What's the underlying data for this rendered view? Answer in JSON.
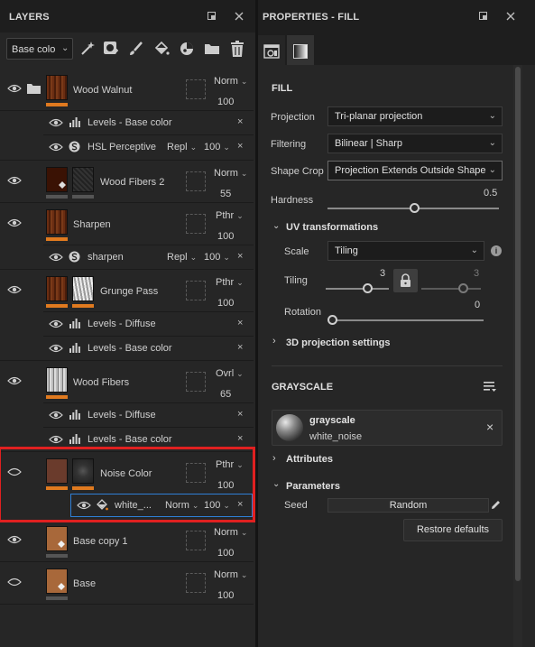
{
  "layers_panel": {
    "title": "LAYERS",
    "channel_select": "Base colo",
    "layers": [
      {
        "name": "Wood Walnut",
        "blend": "Norm",
        "opacity": "100"
      },
      {
        "name": "Wood Fibers 2",
        "blend": "Norm",
        "opacity": "55"
      },
      {
        "name": "Sharpen",
        "blend": "Pthr",
        "opacity": "100"
      },
      {
        "name": "Grunge Pass",
        "blend": "Pthr",
        "opacity": "100"
      },
      {
        "name": "Wood Fibers",
        "blend": "Ovrl",
        "opacity": "65"
      },
      {
        "name": "Noise Color",
        "blend": "Pthr",
        "opacity": "100"
      },
      {
        "name": "Base copy 1",
        "blend": "Norm",
        "opacity": "100"
      },
      {
        "name": "Base",
        "blend": "Norm",
        "opacity": "100"
      }
    ],
    "effects": [
      {
        "name": "Levels - Base color"
      },
      {
        "name": "HSL Perceptive",
        "blend": "Repl",
        "opacity": "100"
      },
      {
        "name": "sharpen",
        "blend": "Repl",
        "opacity": "100"
      },
      {
        "name": "Levels - Diffuse"
      },
      {
        "name": "Levels - Base color"
      },
      {
        "name": "Levels - Diffuse"
      },
      {
        "name": "Levels - Base color"
      },
      {
        "name": "white_...",
        "blend": "Norm",
        "opacity": "100"
      }
    ]
  },
  "properties_panel": {
    "title": "PROPERTIES - FILL",
    "fill_heading": "FILL",
    "projection_label": "Projection",
    "projection_value": "Tri-planar projection",
    "filtering_label": "Filtering",
    "filtering_value": "Bilinear | Sharp",
    "shape_crop_label": "Shape Crop",
    "shape_crop_value": "Projection Extends Outside Shape",
    "hardness_label": "Hardness",
    "hardness_value": "0.5",
    "uv_title": "UV transformations",
    "scale_label": "Scale",
    "scale_value": "Tiling",
    "tiling_label": "Tiling",
    "tiling_value_1": "3",
    "tiling_value_2": "3",
    "rotation_label": "Rotation",
    "rotation_value": "0",
    "projection_settings_title": "3D projection settings",
    "grayscale_heading": "GRAYSCALE",
    "resource_name": "grayscale",
    "resource_sub": "white_noise",
    "attributes_title": "Attributes",
    "parameters_title": "Parameters",
    "seed_label": "Seed",
    "seed_button": "Random",
    "restore_button": "Restore defaults"
  },
  "colors": {
    "accent_orange": "#e07a1f",
    "selection_red": "#e02020",
    "panel_bg": "#252525",
    "header_bg": "#1e1e1e"
  }
}
